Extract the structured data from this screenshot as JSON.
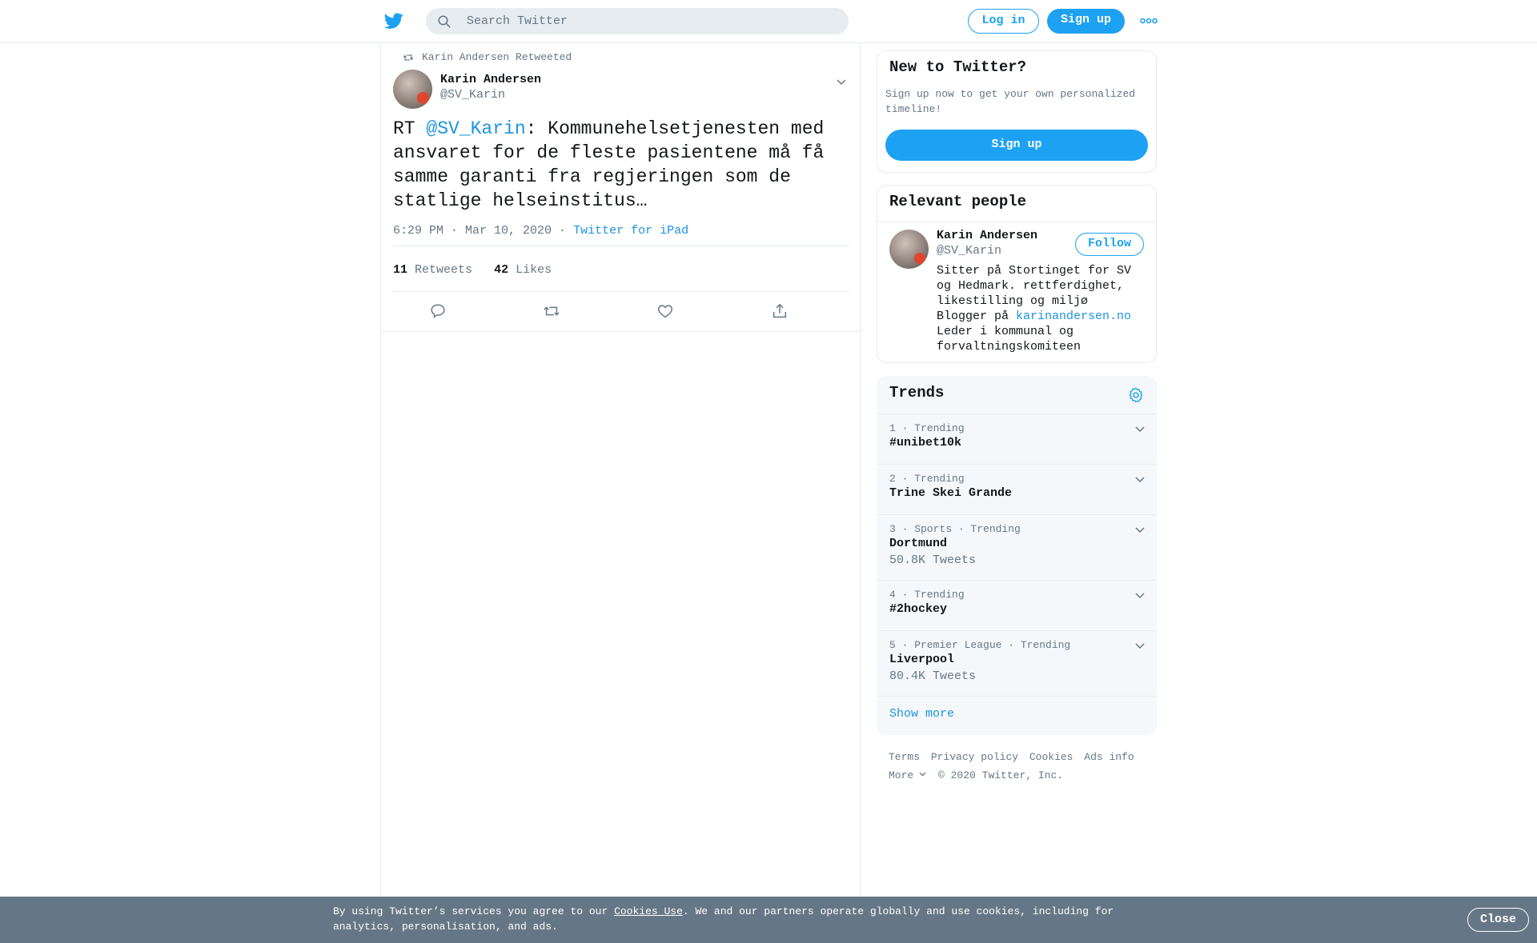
{
  "colors": {
    "accent": "#1da1f2",
    "link": "#1b95e0",
    "muted": "#657786",
    "text": "#14171a",
    "border": "#e6ecf0",
    "cookie_bg": "#657786"
  },
  "header": {
    "logo_icon": "twitter-bird-icon",
    "search_placeholder": "Search Twitter",
    "login_label": "Log in",
    "signup_label": "Sign up",
    "more_icon": "more-dots-icon"
  },
  "tweet": {
    "retweeted_by": "Karin Andersen Retweeted",
    "author_name": "Karin Andersen",
    "author_handle": "@SV_Karin",
    "text_prefix": "RT ",
    "mention": "@SV_Karin",
    "text_body": ": Kommunehelsetjenesten med ansvaret for de fleste pasientene må få samme garanti fra regjeringen som de statlige helseinstitus…",
    "timestamp": "6:29 PM · Mar 10, 2020",
    "separator": " · ",
    "source": "Twitter for iPad",
    "retweets_count": "11",
    "retweets_label": "Retweets",
    "likes_count": "42",
    "likes_label": "Likes"
  },
  "new_to_twitter": {
    "title": "New to Twitter?",
    "subtitle": "Sign up now to get your own personalized timeline!",
    "button": "Sign up"
  },
  "relevant_people": {
    "title": "Relevant people",
    "name": "Karin Andersen",
    "handle": "@SV_Karin",
    "follow": "Follow",
    "bio_line1": "Sitter på Stortinget for SV og Hedmark. rettferdighet, likestilling og miljø",
    "bio_line2_prefix": "Blogger på ",
    "bio_link": "karinandersen.no",
    "bio_line3": "Leder i kommunal og forvaltningskomiteen"
  },
  "trends": {
    "title": "Trends",
    "items": [
      {
        "meta": "1 · Trending",
        "name": "#unibet10k",
        "count": ""
      },
      {
        "meta": "2 · Trending",
        "name": "Trine Skei Grande",
        "count": ""
      },
      {
        "meta": "3 · Sports · Trending",
        "name": "Dortmund",
        "count": "50.8K Tweets"
      },
      {
        "meta": "4 · Trending",
        "name": "#2hockey",
        "count": ""
      },
      {
        "meta": "5 · Premier League · Trending",
        "name": "Liverpool",
        "count": "80.4K Tweets"
      }
    ],
    "show_more": "Show more"
  },
  "footer": {
    "terms": "Terms",
    "privacy": "Privacy policy",
    "cookies": "Cookies",
    "ads": "Ads info",
    "more": "More",
    "copyright": "© 2020 Twitter, Inc."
  },
  "cookie_bar": {
    "text_before": "By using Twitter’s services you agree to our ",
    "link": "Cookies Use",
    "text_after": ". We and our partners operate globally and use cookies, including for analytics, personalisation, and ads.",
    "close": "Close"
  }
}
